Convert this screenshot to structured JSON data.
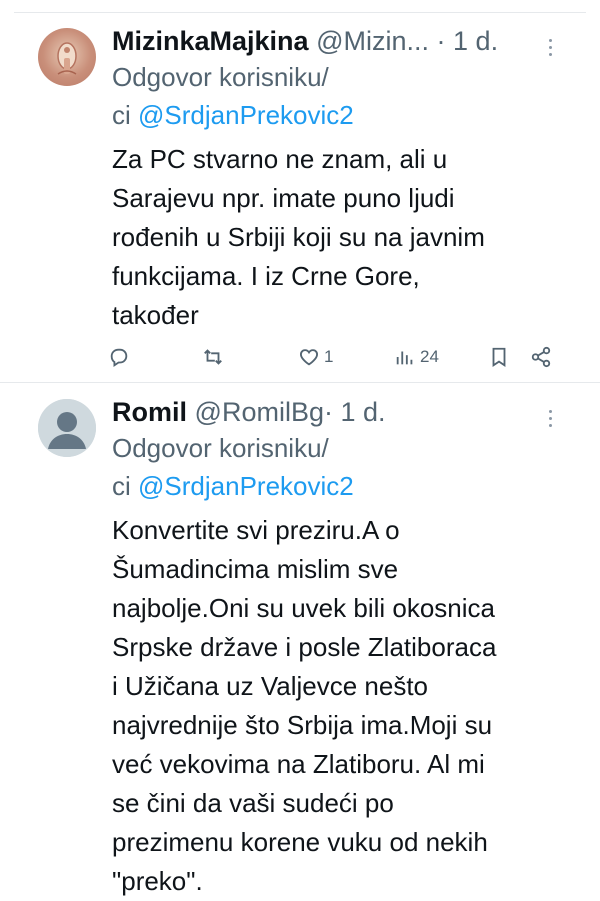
{
  "tweets": [
    {
      "display_name": "MizinkaMajkina",
      "handle": "@Mizin...",
      "separator": "·",
      "time": "1 d.",
      "reply_prefix": "Odgovor korisniku/",
      "reply_prefix_2": "ci",
      "reply_to": "@SrdjanPrekovic2",
      "text": "Za PC stvarno ne znam, ali u\nSarajevu npr. imate puno ljudi\nrođenih u Srbiji koji su na javnim\nfunkcijama. I iz Crne Gore,\ntakođer",
      "likes": "1",
      "views": "24",
      "icons": {
        "reply": "reply-icon",
        "retweet": "retweet-icon",
        "like": "heart-icon",
        "views": "views-icon",
        "bookmark": "bookmark-icon",
        "share": "share-icon",
        "more": "more-icon"
      }
    },
    {
      "display_name": "Romil",
      "handle": "@RomilBg",
      "separator": "·",
      "time": "1 d.",
      "reply_prefix": "Odgovor korisniku/",
      "reply_prefix_2": "ci",
      "reply_to": "@SrdjanPrekovic2",
      "text": "Konvertite svi preziru.A o\nŠumadincima mislim sve\nnajbolje.Oni su uvek bili okosnica\nSrpske države i posle Zlatiboraca\ni Užičana uz Valjevce nešto\nnajvrednije što Srbija ima.Moji su\nveć vekovima na Zlatiboru. Al mi\nse čini da vaši sudeći po\nprezimenu korene vuku od nekih\n\"preko\"."
    }
  ],
  "colors": {
    "accent": "#1d9bf0",
    "secondary_text": "#536471",
    "primary_text": "#0f1419",
    "divider": "#e6e9ec"
  }
}
